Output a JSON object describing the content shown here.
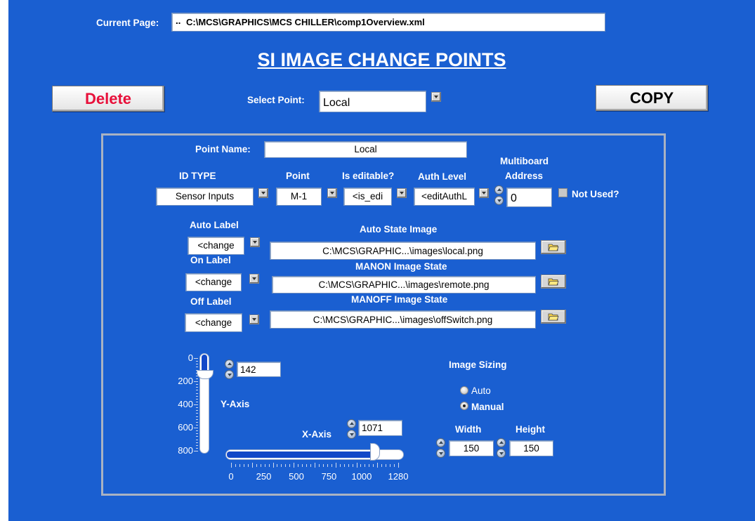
{
  "header": {
    "current_page_label": "Current Page:",
    "current_page_value": "C:\\MCS\\GRAPHICS\\MCS CHILLER\\comp1Overview.xml"
  },
  "title": "SI IMAGE CHANGE POINTS",
  "toolbar": {
    "delete_label": "Delete",
    "copy_label": "COPY",
    "select_point_label": "Select Point:",
    "select_point_value": "Local"
  },
  "point": {
    "name_label": "Point Name:",
    "name_value": "Local",
    "id_type_label": "ID TYPE",
    "id_type_value": "Sensor Inputs",
    "point_label": "Point",
    "point_value": "M-1",
    "editable_label": "Is editable?",
    "editable_value": "<is_edi",
    "auth_label": "Auth Level",
    "auth_value": "<editAuthL",
    "multiboard_label_1": "Multiboard",
    "multiboard_label_2": "Address",
    "multiboard_value": "0",
    "not_used_label": "Not Used?"
  },
  "labels": {
    "auto_label": "Auto Label",
    "auto_value": "<change",
    "auto_image_label": "Auto State Image",
    "auto_image_value": "C:\\MCS\\GRAPHIC...\\images\\local.png",
    "on_label": "On Label",
    "on_value": "<change",
    "manon_image_label": "MANON Image State",
    "manon_image_value": "C:\\MCS\\GRAPHIC...\\images\\remote.png",
    "off_label": "Off Label",
    "off_value": "<change",
    "manoff_image_label": "MANOFF Image State",
    "manoff_image_value": "C:\\MCS\\GRAPHIC...\\images\\offSwitch.png"
  },
  "position": {
    "y_axis_label": "Y-Axis",
    "y_value": "142",
    "y_ticks": [
      "0",
      "200",
      "400",
      "600",
      "800"
    ],
    "y_slider_fraction": 0.16,
    "x_axis_label": "X-Axis",
    "x_value": "1071",
    "x_ticks": [
      "0",
      "250",
      "500",
      "750",
      "1000",
      "1280"
    ],
    "x_slider_fraction": 0.84
  },
  "sizing": {
    "title": "Image Sizing",
    "auto_label": "Auto",
    "manual_label": "Manual",
    "selected": "Manual",
    "width_label": "Width",
    "width_value": "150",
    "height_label": "Height",
    "height_value": "150"
  },
  "colors": {
    "background": "#1a5fd1",
    "delete_text": "#e8103a",
    "panel_border": "#a9b2c2"
  },
  "icons": {
    "folder": "open-folder-icon",
    "dropdown": "dropdown-arrow-icon",
    "spinner": "increment-decrement-icon",
    "page": "page-tree-icon"
  }
}
